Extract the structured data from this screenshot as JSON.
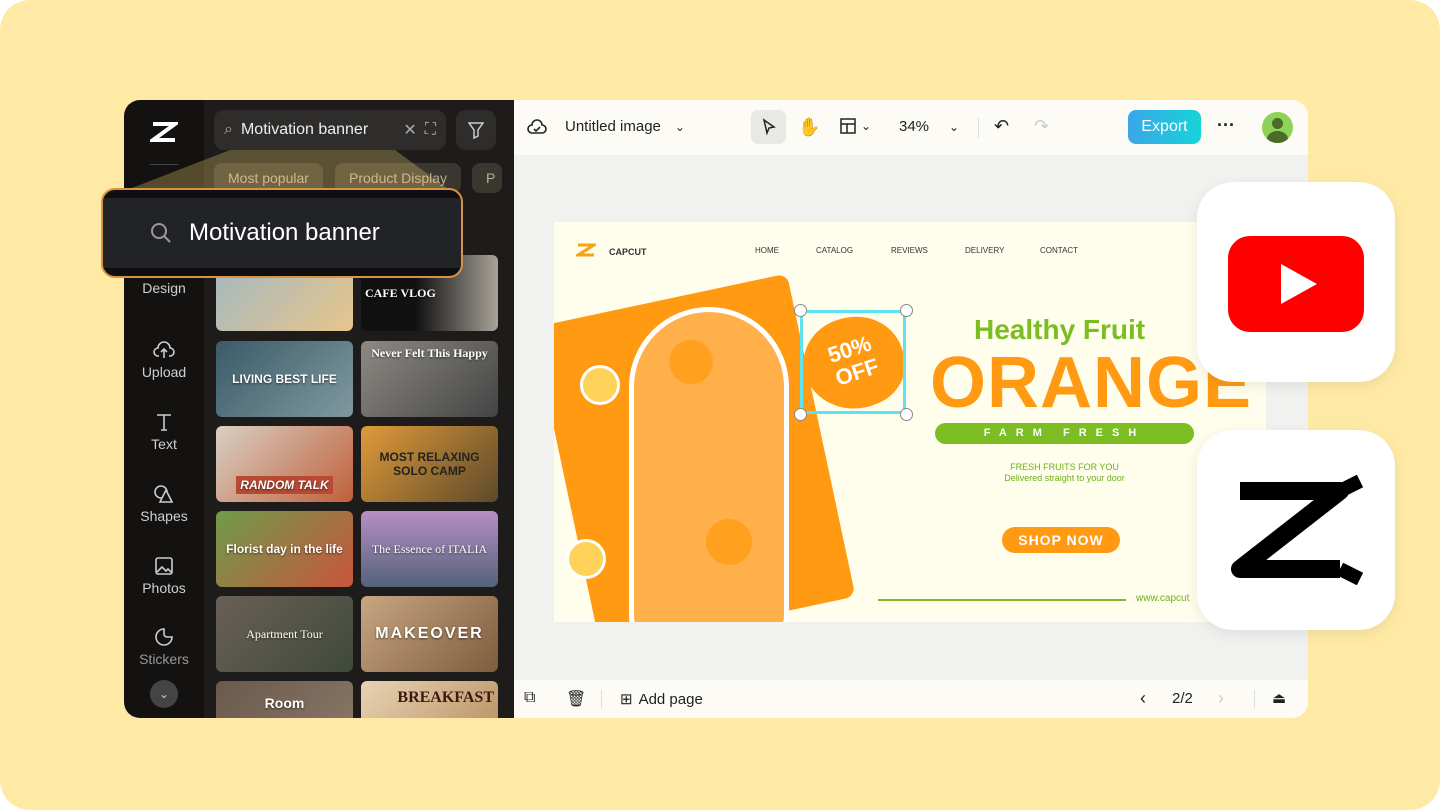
{
  "rail": {
    "items": [
      "Design",
      "Upload",
      "Text",
      "Shapes",
      "Photos",
      "Stickers"
    ]
  },
  "panel": {
    "search_value": "Motivation banner",
    "chips": [
      "Most popular",
      "Product Display",
      "P"
    ],
    "templates": [
      "",
      "CAFE VLOG",
      "LIVING BEST LIFE",
      "Never Felt This Happy",
      "RANDOM TALK",
      "MOST RELAXING SOLO CAMP",
      "Florist day in the life",
      "The Essence of ITALIA",
      "Apartment Tour",
      "MAKEOVER",
      "Room",
      "BREAKFAST"
    ]
  },
  "popup": {
    "search_text": "Motivation banner"
  },
  "topbar": {
    "title": "Untitled image",
    "zoom": "34%",
    "export": "Export"
  },
  "bottombar": {
    "add_page": "Add page",
    "page_indicator": "2/2"
  },
  "banner": {
    "brand": "CAPCUT",
    "nav": [
      "HOME",
      "CATALOG",
      "REVIEWS",
      "DELIVERY",
      "CONTACT"
    ],
    "badge_line1": "50%",
    "badge_line2": "OFF",
    "headline_small": "Healthy Fruit",
    "headline": "ORANGE",
    "ribbon": "FARM FRESH",
    "tag1": "FRESH FRUITS FOR YOU",
    "tag2": "Delivered straight to your door",
    "cta": "SHOP NOW",
    "url": "www.capcut"
  },
  "colors": {
    "orange": "#ff9a12",
    "green": "#7bbd22",
    "accent": "#17d3d8"
  }
}
